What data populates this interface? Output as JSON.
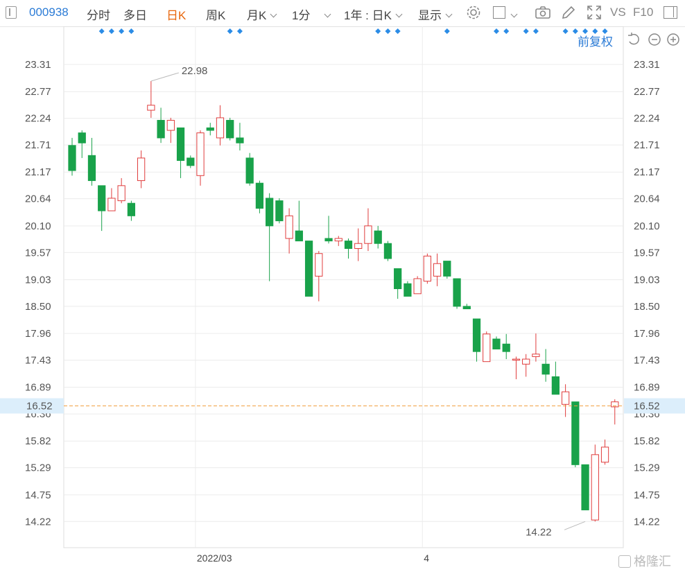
{
  "toolbar": {
    "code": "000938",
    "tabs": [
      "分时",
      "多日",
      "日K",
      "周K",
      "月K",
      "1分"
    ],
    "range": "1年 : 日K",
    "display": "显示",
    "vs": "VS",
    "f10": "F10"
  },
  "adjust_label": "前复权",
  "watermark": "格隆汇",
  "colors": {
    "up": "#e03c3c",
    "down": "#19a24a",
    "accent": "#e8650a",
    "link": "#2b7bd6",
    "price_line": "#f0a040"
  },
  "chart_data": {
    "type": "candlestick",
    "y_ticks": [
      "23.31",
      "22.77",
      "22.24",
      "21.71",
      "21.17",
      "20.64",
      "20.10",
      "19.57",
      "19.03",
      "18.50",
      "17.96",
      "17.43",
      "16.89",
      "16.36",
      "15.82",
      "15.29",
      "14.75",
      "14.22"
    ],
    "ylim": [
      13.7,
      23.6
    ],
    "x_labels": [
      {
        "index": 13,
        "label": "2022/03"
      },
      {
        "index": 36,
        "label": "4"
      }
    ],
    "current_price": "16.52",
    "max_label": {
      "index": 8,
      "value": "22.98"
    },
    "min_label": {
      "index": 52,
      "value": "14.22"
    },
    "marker_groups": [
      [
        3,
        4,
        5,
        6
      ],
      [
        16,
        17
      ],
      [
        31,
        32,
        33
      ],
      [
        38
      ],
      [
        43,
        44
      ],
      [
        46,
        47
      ],
      [
        50,
        51,
        52,
        53,
        54
      ]
    ],
    "candles": [
      [
        21.7,
        21.2,
        21.85,
        21.1
      ],
      [
        21.95,
        21.75,
        22.0,
        21.45
      ],
      [
        21.5,
        21.0,
        21.85,
        20.9
      ],
      [
        20.9,
        20.4,
        20.9,
        20.0
      ],
      [
        20.4,
        20.65,
        20.85,
        20.4
      ],
      [
        20.6,
        20.9,
        21.05,
        20.55
      ],
      [
        20.55,
        20.3,
        20.6,
        20.2
      ],
      [
        21.0,
        21.45,
        21.6,
        20.85
      ],
      [
        22.4,
        22.5,
        22.98,
        22.25
      ],
      [
        22.2,
        21.85,
        22.45,
        21.75
      ],
      [
        22.0,
        22.2,
        22.25,
        21.75
      ],
      [
        22.05,
        21.4,
        22.05,
        21.05
      ],
      [
        21.45,
        21.3,
        21.5,
        21.25
      ],
      [
        21.1,
        21.95,
        22.0,
        20.9
      ],
      [
        22.05,
        22.0,
        22.15,
        21.9
      ],
      [
        21.85,
        22.25,
        22.5,
        21.7
      ],
      [
        22.2,
        21.85,
        22.25,
        21.8
      ],
      [
        21.85,
        21.75,
        22.15,
        21.6
      ],
      [
        21.45,
        20.95,
        21.55,
        20.9
      ],
      [
        20.95,
        20.45,
        21.0,
        20.35
      ],
      [
        20.65,
        20.1,
        20.75,
        19.0
      ],
      [
        20.6,
        20.2,
        20.65,
        20.15
      ],
      [
        19.85,
        20.3,
        20.45,
        19.55
      ],
      [
        20.0,
        19.8,
        20.6,
        19.8
      ],
      [
        19.8,
        18.7,
        19.8,
        18.7
      ],
      [
        19.1,
        19.55,
        19.6,
        18.6
      ],
      [
        19.85,
        19.8,
        20.3,
        19.75
      ],
      [
        19.8,
        19.85,
        19.9,
        19.7
      ],
      [
        19.8,
        19.65,
        19.85,
        19.45
      ],
      [
        19.65,
        19.75,
        20.05,
        19.4
      ],
      [
        19.75,
        20.1,
        20.45,
        19.6
      ],
      [
        20.0,
        19.75,
        20.1,
        19.65
      ],
      [
        19.75,
        19.45,
        19.8,
        19.4
      ],
      [
        19.25,
        18.85,
        19.25,
        18.65
      ],
      [
        18.95,
        18.7,
        19.0,
        18.7
      ],
      [
        18.75,
        19.05,
        19.1,
        18.75
      ],
      [
        19.0,
        19.5,
        19.55,
        18.95
      ],
      [
        19.1,
        19.35,
        19.55,
        18.9
      ],
      [
        19.4,
        19.1,
        19.4,
        19.05
      ],
      [
        19.05,
        18.5,
        19.05,
        18.45
      ],
      [
        18.5,
        18.45,
        18.55,
        18.45
      ],
      [
        18.25,
        17.6,
        18.25,
        17.4
      ],
      [
        17.4,
        17.95,
        18.0,
        17.4
      ],
      [
        17.85,
        17.65,
        17.9,
        17.65
      ],
      [
        17.75,
        17.6,
        17.95,
        17.45
      ],
      [
        17.45,
        17.45,
        17.5,
        17.05
      ],
      [
        17.35,
        17.45,
        17.55,
        17.1
      ],
      [
        17.5,
        17.55,
        17.96,
        17.4
      ],
      [
        17.35,
        17.15,
        17.65,
        17.0
      ],
      [
        17.1,
        16.75,
        17.4,
        16.75
      ],
      [
        16.55,
        16.8,
        16.95,
        16.3
      ],
      [
        16.6,
        15.35,
        16.6,
        15.3
      ],
      [
        15.35,
        14.45,
        15.35,
        14.45
      ],
      [
        14.25,
        15.55,
        15.75,
        14.22
      ],
      [
        15.4,
        15.7,
        15.85,
        15.35
      ],
      [
        16.5,
        16.6,
        16.65,
        16.15
      ]
    ]
  }
}
